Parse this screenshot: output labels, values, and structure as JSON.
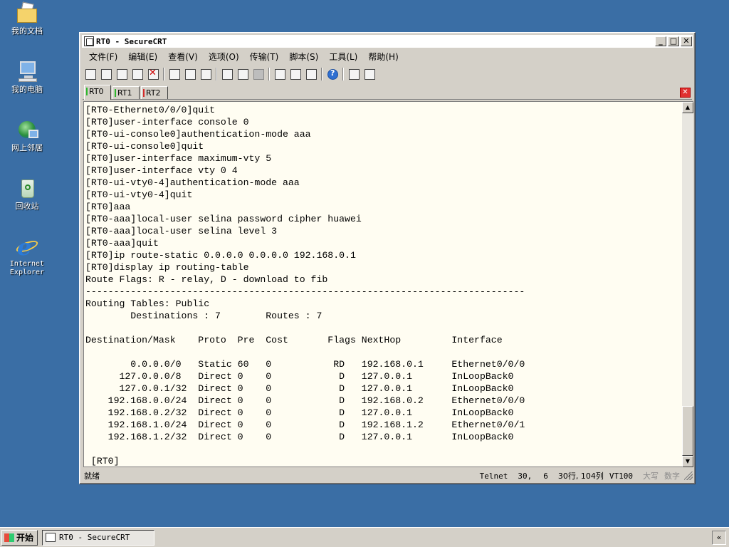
{
  "desktop": {
    "icons": [
      {
        "label": "我的文档",
        "icon": "my-documents-icon"
      },
      {
        "label": "我的电脑",
        "icon": "my-computer-icon"
      },
      {
        "label": "网上邻居",
        "icon": "network-places-icon"
      },
      {
        "label": "回收站",
        "icon": "recycle-bin-icon"
      },
      {
        "label": "Internet\nExplorer",
        "icon": "internet-explorer-icon"
      }
    ]
  },
  "window": {
    "title": "RT0 - SecureCRT",
    "minimize": "_",
    "maximize": "□",
    "close": "✕"
  },
  "menu": [
    "文件(F)",
    "编辑(E)",
    "查看(V)",
    "选项(O)",
    "传输(T)",
    "脚本(S)",
    "工具(L)",
    "帮助(H)"
  ],
  "tabs": [
    {
      "label": "RT0",
      "color": "#2db82d"
    },
    {
      "label": "RT1",
      "color": "#2db82d"
    },
    {
      "label": "RT2",
      "color": "#d42a2a"
    }
  ],
  "terminal": {
    "lines": [
      "[RT0-Ethernet0/0/0]quit",
      "[RT0]user-interface console 0",
      "[RT0-ui-console0]authentication-mode aaa",
      "[RT0-ui-console0]quit",
      "[RT0]user-interface maximum-vty 5",
      "[RT0]user-interface vty 0 4",
      "[RT0-ui-vty0-4]authentication-mode aaa",
      "[RT0-ui-vty0-4]quit",
      "[RT0]aaa",
      "[RT0-aaa]local-user selina password cipher huawei",
      "[RT0-aaa]local-user selina level 3",
      "[RT0-aaa]quit",
      "[RT0]ip route-static 0.0.0.0 0.0.0.0 192.168.0.1",
      "[RT0]display ip routing-table",
      "Route Flags: R - relay, D - download to fib",
      "------------------------------------------------------------------------------",
      "Routing Tables: Public",
      "        Destinations : 7        Routes : 7",
      "",
      "Destination/Mask    Proto  Pre  Cost       Flags NextHop         Interface",
      "",
      "        0.0.0.0/0   Static 60   0           RD   192.168.0.1     Ethernet0/0/0",
      "      127.0.0.0/8   Direct 0    0            D   127.0.0.1       InLoopBack0",
      "      127.0.0.1/32  Direct 0    0            D   127.0.0.1       InLoopBack0",
      "    192.168.0.0/24  Direct 0    0            D   192.168.0.2     Ethernet0/0/0",
      "    192.168.0.2/32  Direct 0    0            D   127.0.0.1       InLoopBack0",
      "    192.168.1.0/24  Direct 0    0            D   192.168.1.2     Ethernet0/0/1",
      "    192.168.1.2/32  Direct 0    0            D   127.0.0.1       InLoopBack0",
      "",
      " [RT0]"
    ]
  },
  "status": {
    "ready": "就绪",
    "protocol": "Telnet",
    "row": "30,",
    "col": "6",
    "size": "30行, 104列",
    "emulation": "VT100",
    "caps": "大写",
    "num": "数字"
  },
  "taskbar": {
    "start": "开始",
    "task": "RT0 - SecureCRT",
    "tray": "«"
  }
}
